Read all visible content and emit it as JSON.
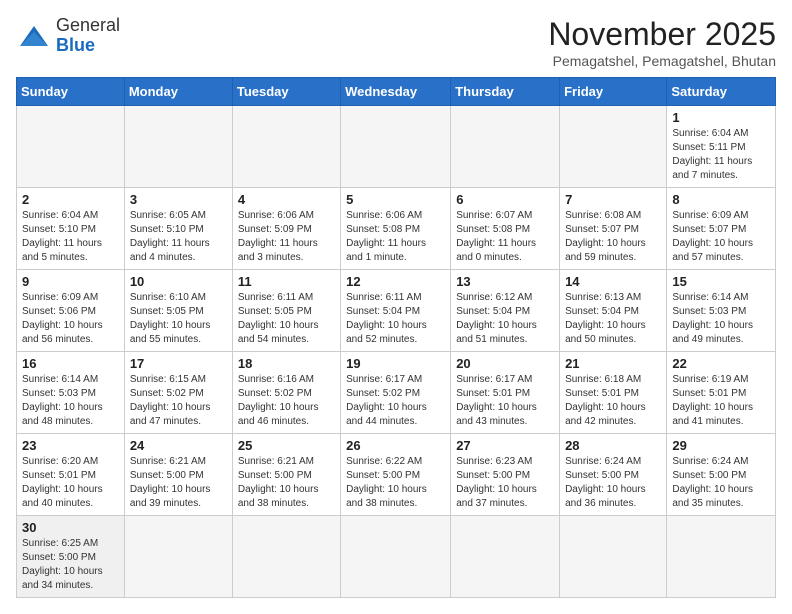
{
  "header": {
    "logo_general": "General",
    "logo_blue": "Blue",
    "title": "November 2025",
    "subtitle": "Pemagatshel, Pemagatshel, Bhutan"
  },
  "weekdays": [
    "Sunday",
    "Monday",
    "Tuesday",
    "Wednesday",
    "Thursday",
    "Friday",
    "Saturday"
  ],
  "weeks": [
    [
      {
        "day": "",
        "info": ""
      },
      {
        "day": "",
        "info": ""
      },
      {
        "day": "",
        "info": ""
      },
      {
        "day": "",
        "info": ""
      },
      {
        "day": "",
        "info": ""
      },
      {
        "day": "",
        "info": ""
      },
      {
        "day": "1",
        "info": "Sunrise: 6:04 AM\nSunset: 5:11 PM\nDaylight: 11 hours and 7 minutes."
      }
    ],
    [
      {
        "day": "2",
        "info": "Sunrise: 6:04 AM\nSunset: 5:10 PM\nDaylight: 11 hours and 5 minutes."
      },
      {
        "day": "3",
        "info": "Sunrise: 6:05 AM\nSunset: 5:10 PM\nDaylight: 11 hours and 4 minutes."
      },
      {
        "day": "4",
        "info": "Sunrise: 6:06 AM\nSunset: 5:09 PM\nDaylight: 11 hours and 3 minutes."
      },
      {
        "day": "5",
        "info": "Sunrise: 6:06 AM\nSunset: 5:08 PM\nDaylight: 11 hours and 1 minute."
      },
      {
        "day": "6",
        "info": "Sunrise: 6:07 AM\nSunset: 5:08 PM\nDaylight: 11 hours and 0 minutes."
      },
      {
        "day": "7",
        "info": "Sunrise: 6:08 AM\nSunset: 5:07 PM\nDaylight: 10 hours and 59 minutes."
      },
      {
        "day": "8",
        "info": "Sunrise: 6:09 AM\nSunset: 5:07 PM\nDaylight: 10 hours and 57 minutes."
      }
    ],
    [
      {
        "day": "9",
        "info": "Sunrise: 6:09 AM\nSunset: 5:06 PM\nDaylight: 10 hours and 56 minutes."
      },
      {
        "day": "10",
        "info": "Sunrise: 6:10 AM\nSunset: 5:05 PM\nDaylight: 10 hours and 55 minutes."
      },
      {
        "day": "11",
        "info": "Sunrise: 6:11 AM\nSunset: 5:05 PM\nDaylight: 10 hours and 54 minutes."
      },
      {
        "day": "12",
        "info": "Sunrise: 6:11 AM\nSunset: 5:04 PM\nDaylight: 10 hours and 52 minutes."
      },
      {
        "day": "13",
        "info": "Sunrise: 6:12 AM\nSunset: 5:04 PM\nDaylight: 10 hours and 51 minutes."
      },
      {
        "day": "14",
        "info": "Sunrise: 6:13 AM\nSunset: 5:04 PM\nDaylight: 10 hours and 50 minutes."
      },
      {
        "day": "15",
        "info": "Sunrise: 6:14 AM\nSunset: 5:03 PM\nDaylight: 10 hours and 49 minutes."
      }
    ],
    [
      {
        "day": "16",
        "info": "Sunrise: 6:14 AM\nSunset: 5:03 PM\nDaylight: 10 hours and 48 minutes."
      },
      {
        "day": "17",
        "info": "Sunrise: 6:15 AM\nSunset: 5:02 PM\nDaylight: 10 hours and 47 minutes."
      },
      {
        "day": "18",
        "info": "Sunrise: 6:16 AM\nSunset: 5:02 PM\nDaylight: 10 hours and 46 minutes."
      },
      {
        "day": "19",
        "info": "Sunrise: 6:17 AM\nSunset: 5:02 PM\nDaylight: 10 hours and 44 minutes."
      },
      {
        "day": "20",
        "info": "Sunrise: 6:17 AM\nSunset: 5:01 PM\nDaylight: 10 hours and 43 minutes."
      },
      {
        "day": "21",
        "info": "Sunrise: 6:18 AM\nSunset: 5:01 PM\nDaylight: 10 hours and 42 minutes."
      },
      {
        "day": "22",
        "info": "Sunrise: 6:19 AM\nSunset: 5:01 PM\nDaylight: 10 hours and 41 minutes."
      }
    ],
    [
      {
        "day": "23",
        "info": "Sunrise: 6:20 AM\nSunset: 5:01 PM\nDaylight: 10 hours and 40 minutes."
      },
      {
        "day": "24",
        "info": "Sunrise: 6:21 AM\nSunset: 5:00 PM\nDaylight: 10 hours and 39 minutes."
      },
      {
        "day": "25",
        "info": "Sunrise: 6:21 AM\nSunset: 5:00 PM\nDaylight: 10 hours and 38 minutes."
      },
      {
        "day": "26",
        "info": "Sunrise: 6:22 AM\nSunset: 5:00 PM\nDaylight: 10 hours and 38 minutes."
      },
      {
        "day": "27",
        "info": "Sunrise: 6:23 AM\nSunset: 5:00 PM\nDaylight: 10 hours and 37 minutes."
      },
      {
        "day": "28",
        "info": "Sunrise: 6:24 AM\nSunset: 5:00 PM\nDaylight: 10 hours and 36 minutes."
      },
      {
        "day": "29",
        "info": "Sunrise: 6:24 AM\nSunset: 5:00 PM\nDaylight: 10 hours and 35 minutes."
      }
    ],
    [
      {
        "day": "30",
        "info": "Sunrise: 6:25 AM\nSunset: 5:00 PM\nDaylight: 10 hours and 34 minutes."
      },
      {
        "day": "",
        "info": ""
      },
      {
        "day": "",
        "info": ""
      },
      {
        "day": "",
        "info": ""
      },
      {
        "day": "",
        "info": ""
      },
      {
        "day": "",
        "info": ""
      },
      {
        "day": "",
        "info": ""
      }
    ]
  ]
}
